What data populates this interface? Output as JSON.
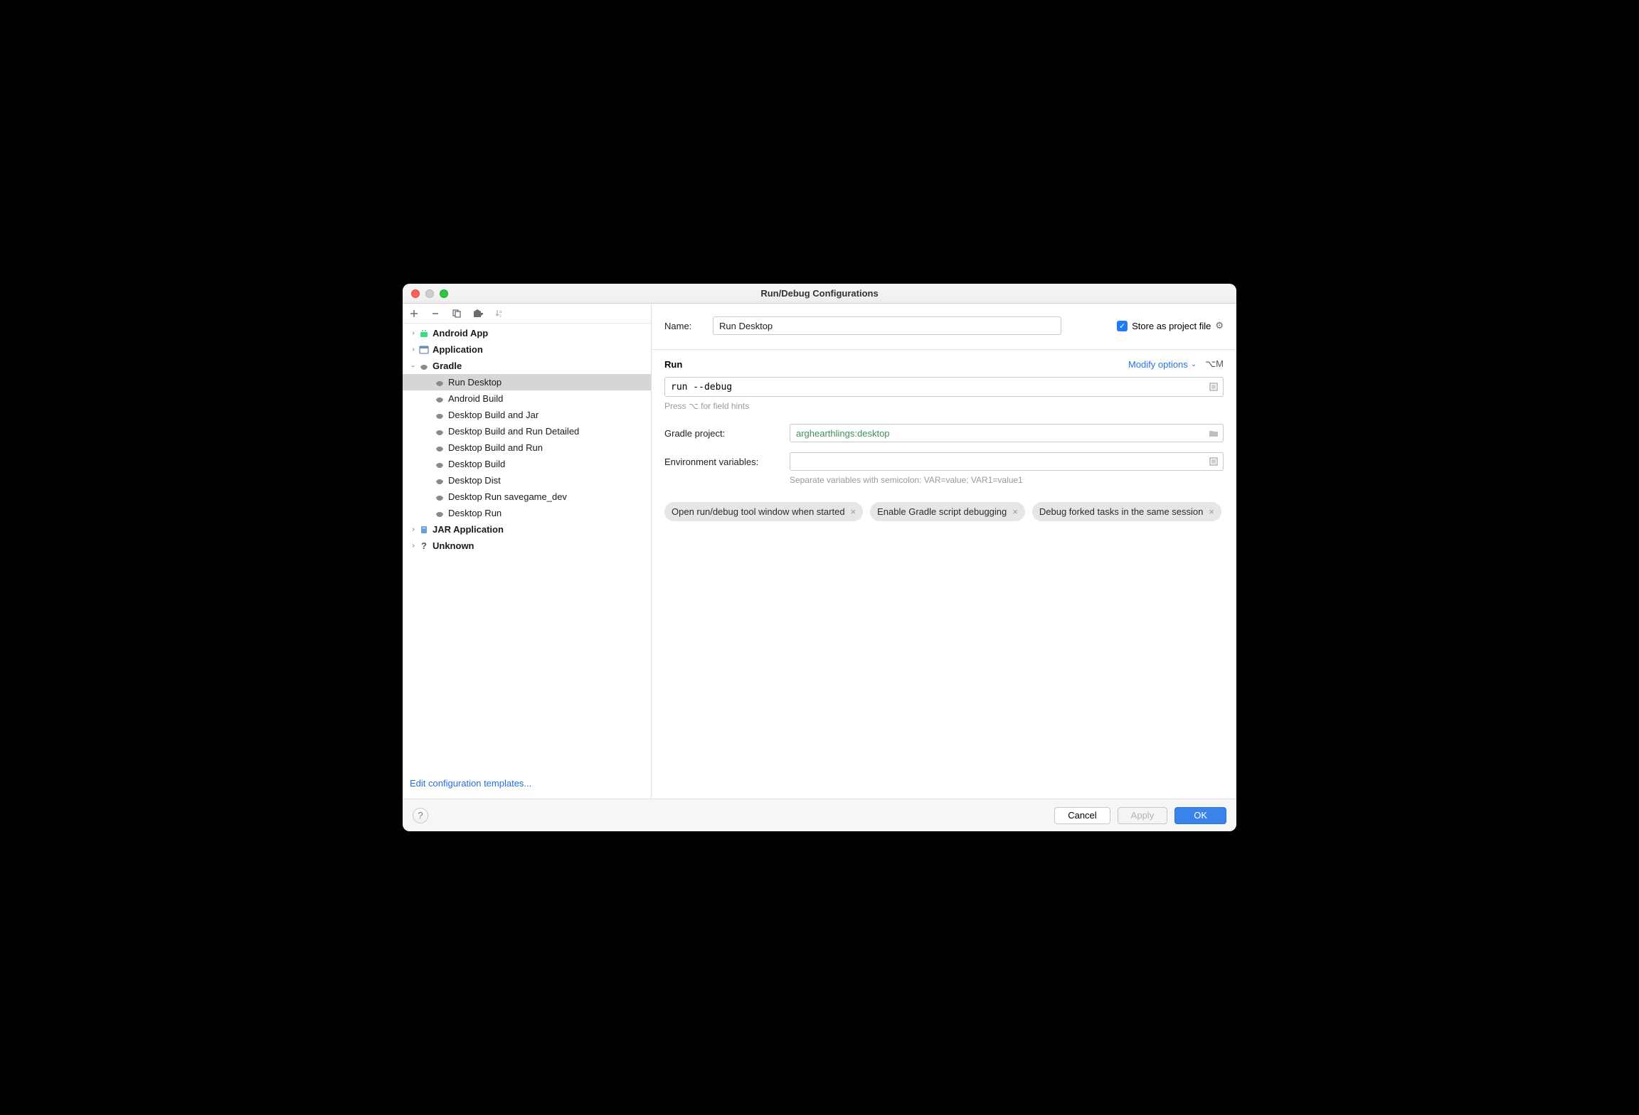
{
  "window": {
    "title": "Run/Debug Configurations"
  },
  "toolbar": {
    "add": "+",
    "remove": "−",
    "copy": "⧉",
    "save": "📁",
    "sort": "↓ᵃ"
  },
  "tree": {
    "android_app": "Android App",
    "application": "Application",
    "gradle": "Gradle",
    "gradle_children": [
      "Run Desktop",
      "Android Build",
      "Desktop Build and Jar",
      "Desktop Build and Run Detailed",
      "Desktop Build and Run",
      "Desktop Build",
      "Desktop Dist",
      "Desktop Run savegame_dev",
      "Desktop Run"
    ],
    "jar_application": "JAR Application",
    "unknown": "Unknown"
  },
  "edit_templates": "Edit configuration templates...",
  "form": {
    "name_label": "Name:",
    "name_value": "Run Desktop",
    "store_label": "Store as project file",
    "run_section": "Run",
    "modify_options": "Modify options",
    "modify_shortcut": "⌥M",
    "run_command": "run --debug",
    "press_hint": "Press ⌥ for field hints",
    "gradle_project_label": "Gradle project:",
    "gradle_project_value": "arghearthlings:desktop",
    "env_label": "Environment variables:",
    "env_value": "",
    "env_hint": "Separate variables with semicolon: VAR=value; VAR1=value1",
    "tags": [
      "Open run/debug tool window when started",
      "Enable Gradle script debugging",
      "Debug forked tasks in the same session"
    ]
  },
  "footer": {
    "cancel": "Cancel",
    "apply": "Apply",
    "ok": "OK"
  }
}
